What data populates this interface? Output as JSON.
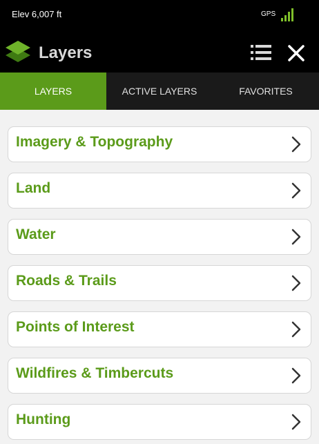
{
  "status_bar": {
    "elevation": "Elev 6,007 ft",
    "gps_label": "GPS",
    "signal_icon": "signal-bars-icon",
    "signal_color": "#7fbf2a"
  },
  "header": {
    "title": "Layers",
    "logo_icon": "layers-icon",
    "menu_icon": "list-icon",
    "close_icon": "close-icon"
  },
  "tabs": [
    {
      "label": "LAYERS",
      "active": true
    },
    {
      "label": "ACTIVE LAYERS",
      "active": false
    },
    {
      "label": "FAVORITES",
      "active": false
    }
  ],
  "categories": [
    {
      "label": "Imagery & Topography",
      "icon": "chevron-right-icon"
    },
    {
      "label": "Land",
      "icon": "chevron-right-icon"
    },
    {
      "label": "Water",
      "icon": "chevron-right-icon"
    },
    {
      "label": "Roads & Trails",
      "icon": "chevron-right-icon"
    },
    {
      "label": "Points of Interest",
      "icon": "chevron-right-icon"
    },
    {
      "label": "Wildfires & Timbercuts",
      "icon": "chevron-right-icon"
    },
    {
      "label": "Hunting",
      "icon": "chevron-right-icon"
    }
  ],
  "colors": {
    "accent": "#5b9b1a",
    "header_bg": "#000000",
    "tab_bar_bg": "#1a1a1a",
    "page_bg": "#f2f2f2"
  }
}
